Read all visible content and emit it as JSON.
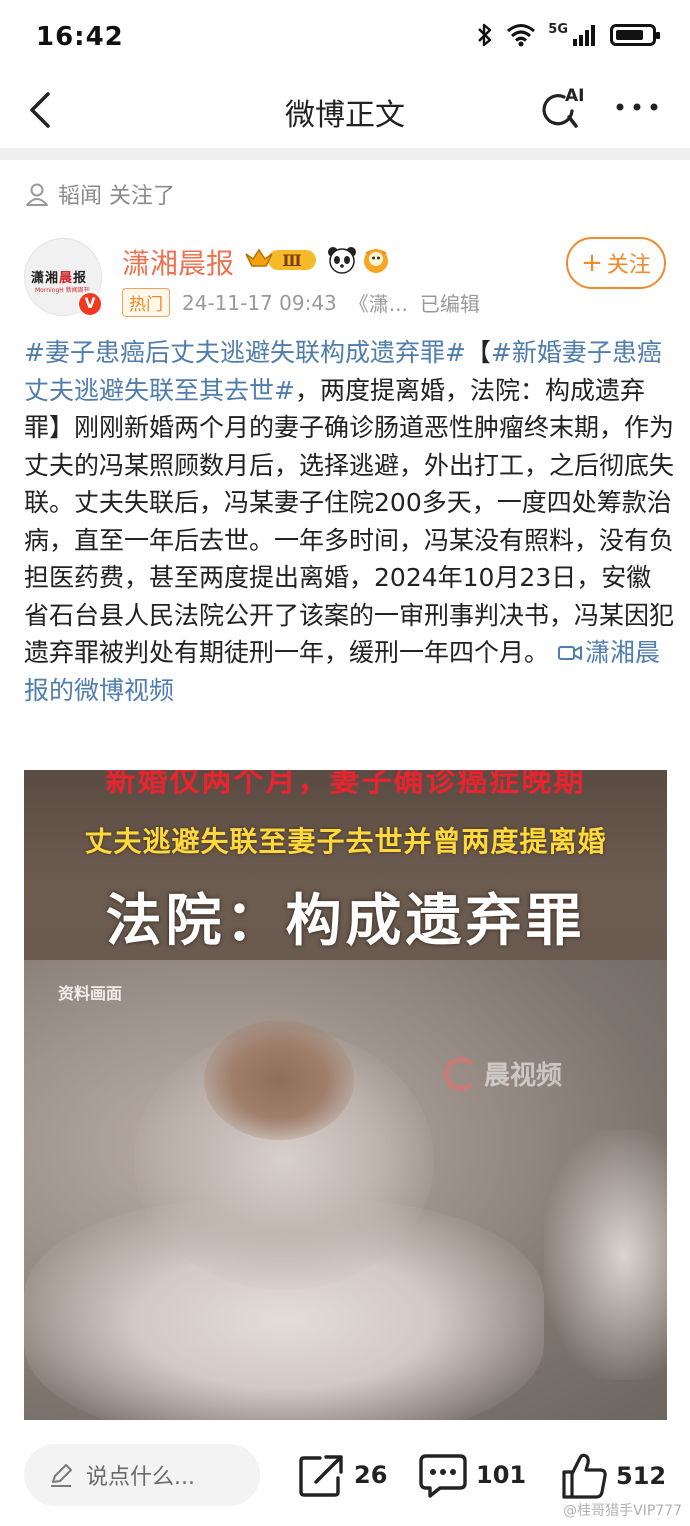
{
  "status_bar": {
    "time": "16:42",
    "network_label": "5G",
    "battery_level": 0.8,
    "icons": [
      "bluetooth-icon",
      "wifi-icon",
      "signal-icon",
      "battery-icon"
    ]
  },
  "nav": {
    "title": "微博正文",
    "back_icon": "back-chevron-icon",
    "ai_label": "AI",
    "more_icon": "more-dots-icon"
  },
  "followed_line": {
    "text": "韬闻 关注了",
    "icon": "person-outline-icon"
  },
  "author": {
    "name": "潇湘晨报",
    "avatar_logo_left": "潇湘",
    "avatar_logo_red": "晨",
    "avatar_logo_right": "报",
    "avatar_logo_sub": "MorningH 新闻周刊",
    "verified_mark": "V",
    "level_badge": "Ⅲ",
    "hot_tag": "热门",
    "date": "24-11-17 09:43",
    "source": "《潇...",
    "edited": "已编辑",
    "follow_label": "关注",
    "follow_plus": "+"
  },
  "post": {
    "hashtag1": "#妻子患癌后丈夫逃避失联构成遗弃罪#",
    "bracket_open": "【",
    "hashtag2": "#新婚妻子患癌丈夫逃避失联至其去世#",
    "body": "，两度提离婚，法院：构成遗弃罪】刚刚新婚两个月的妻子确诊肠道恶性肿瘤终末期，作为丈夫的冯某照顾数月后，选择逃避，外出打工，之后彻底失联。丈夫失联后，冯某妻子住院200多天，一度四处筹款治病，直至一年后去世。一年多时间，冯某没有照料，没有负担医药费，甚至两度提出离婚，2024年10月23日，安徽省石台县人民法院公开了该案的一审刑事判决书，冯某因犯遗弃罪被判处有期徒刑一年，缓刑一年四个月。",
    "video_link": "潇湘晨报的微博视频"
  },
  "media": {
    "caption_top": "新婚仅两个月，妻子确诊癌症晚期",
    "caption_middle": "丈夫逃避失联至妻子去世并曾两度提离婚",
    "caption_main": "法院：构成遗弃罪",
    "archive_label": "资料画面",
    "watermark": "晨视频"
  },
  "bottom_bar": {
    "comment_placeholder": "说点什么...",
    "share_count": "26",
    "comment_count": "101",
    "like_count": "512",
    "user_watermark": "@桂哥猎手VIP777"
  },
  "colors": {
    "author_name": "#eb7350",
    "link_blue": "#507daf",
    "follow_orange": "#f28a2b",
    "hot_tag": "#f08a24"
  }
}
